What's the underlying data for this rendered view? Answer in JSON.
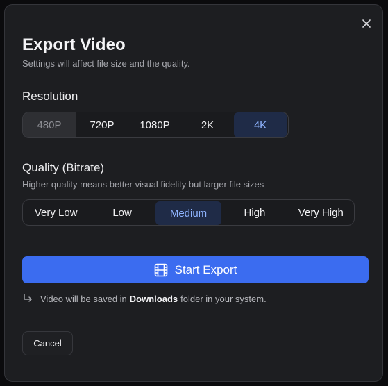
{
  "dialog": {
    "title": "Export Video",
    "subtitle": "Settings will affect file size and the quality.",
    "close_icon": "close-icon"
  },
  "resolution": {
    "label": "Resolution",
    "options": [
      {
        "label": "480P",
        "state": "disabled"
      },
      {
        "label": "720P",
        "state": "normal"
      },
      {
        "label": "1080P",
        "state": "normal"
      },
      {
        "label": "2K",
        "state": "normal"
      },
      {
        "label": "4K",
        "state": "selected"
      }
    ]
  },
  "quality": {
    "label": "Quality (Bitrate)",
    "description": "Higher quality means better visual fidelity but larger file sizes",
    "options": [
      {
        "label": "Very Low",
        "state": "normal"
      },
      {
        "label": "Low",
        "state": "normal"
      },
      {
        "label": "Medium",
        "state": "selected"
      },
      {
        "label": "High",
        "state": "normal"
      },
      {
        "label": "Very High",
        "state": "normal"
      }
    ]
  },
  "export": {
    "label": "Start Export",
    "icon": "film-icon"
  },
  "note": {
    "prefix": "Video will be saved in",
    "folder": "Downloads",
    "suffix": "folder in your system.",
    "icon": "return-arrow-icon"
  },
  "cancel": {
    "label": "Cancel"
  },
  "colors": {
    "accent": "#3b6cf0",
    "selected_bg": "#1f2b47",
    "selected_text": "#8fb4ff",
    "dialog_bg": "#1d1e21"
  }
}
